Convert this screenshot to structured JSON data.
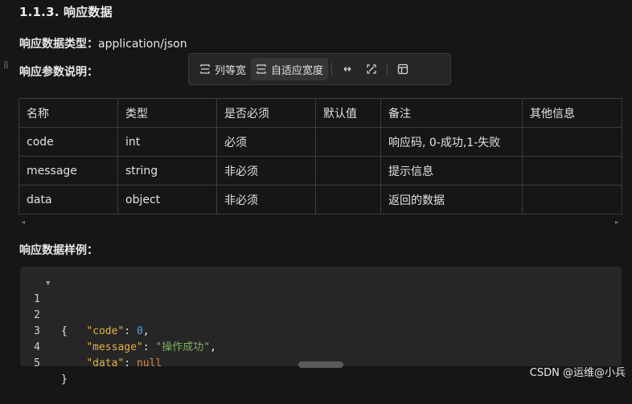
{
  "section_heading": "1.1.3. 响应数据",
  "response_type": {
    "label": "响应数据类型：",
    "value": "application/json"
  },
  "params_title": "响应参数说明：",
  "toolbar": {
    "equal_width_label": "列等宽",
    "auto_width_label": "自适应宽度",
    "active": "自适应宽度"
  },
  "table": {
    "headers": [
      "名称",
      "类型",
      "是否必须",
      "默认值",
      "备注",
      "其他信息"
    ],
    "rows": [
      [
        "code",
        "int",
        "必须",
        "",
        "响应码, 0-成功,1-失败",
        ""
      ],
      [
        "message",
        "string",
        "非必须",
        "",
        "提示信息",
        ""
      ],
      [
        "data",
        "object",
        "非必须",
        "",
        "返回的数据",
        ""
      ]
    ]
  },
  "example_title": "响应数据样例：",
  "code_lines": {
    "numbers": [
      "1",
      "2",
      "3",
      "4",
      "5"
    ],
    "l1": "{",
    "l2_key": "\"code\"",
    "l2_val": "0",
    "l3_key": "\"message\"",
    "l3_val": "\"操作成功\"",
    "l4_key": "\"data\"",
    "l4_val": "null",
    "l5": "}"
  },
  "watermark": "CSDN @运维@小兵"
}
